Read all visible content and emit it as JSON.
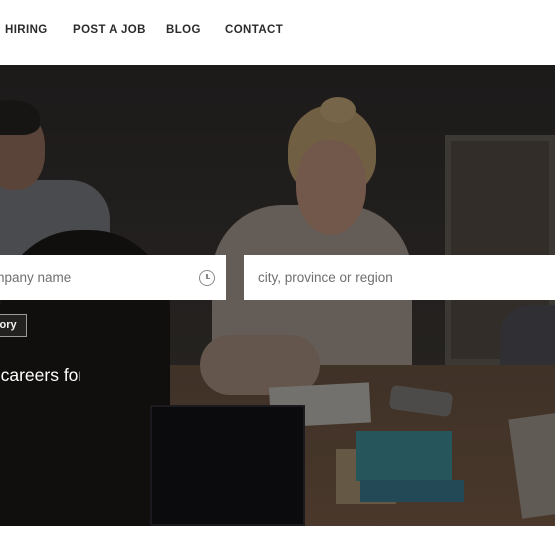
{
  "nav": {
    "items": [
      {
        "label": "HIRING"
      },
      {
        "label": "POST A JOB"
      },
      {
        "label": "BLOG"
      },
      {
        "label": "CONTACT"
      }
    ]
  },
  "search": {
    "keyword_placeholder": "Company name",
    "location_placeholder": "city, province or region",
    "category_label": "Category"
  },
  "hero": {
    "tagline": "We have careers for you!"
  },
  "colors": {
    "nav_text": "#2b2b2b",
    "hero_overlay": "#1b1917",
    "field_bg": "#ffffff"
  },
  "icons": {
    "time_icon": "clock-icon"
  }
}
